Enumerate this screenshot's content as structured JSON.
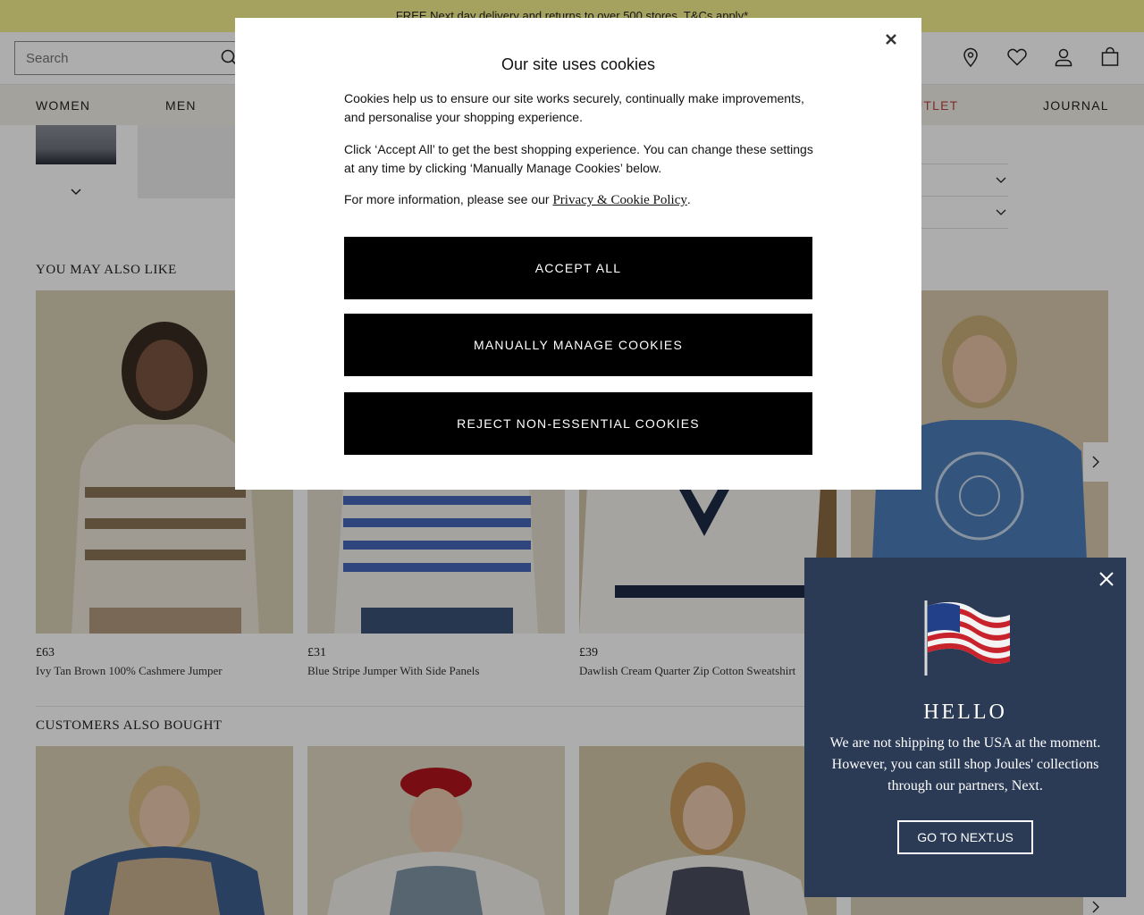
{
  "promo": {
    "text": "FREE Next day delivery and returns to over 500 stores. T&Cs apply*"
  },
  "header": {
    "search_placeholder": "Search",
    "icons": [
      "store-locator-icon",
      "wishlist-heart-icon",
      "account-icon",
      "shopping-bag-icon"
    ]
  },
  "nav": {
    "items": [
      {
        "label": "WOMEN"
      },
      {
        "label": "MEN"
      },
      {
        "label": "OUTLET"
      },
      {
        "label": "JOURNAL"
      }
    ],
    "outlet_color": "#b5453f"
  },
  "sections": {
    "also_like_title": "YOU MAY ALSO LIKE",
    "also_bought_title": "CUSTOMERS ALSO BOUGHT"
  },
  "products": [
    {
      "price": "£63",
      "name": "Ivy Tan Brown 100% Cashmere Jumper"
    },
    {
      "price": "£31",
      "name": "Blue Stripe Jumper With Side Panels"
    },
    {
      "price": "£39",
      "name": "Dawlish Cream Quarter Zip Cotton Sweatshirt"
    },
    {
      "price": "",
      "name": ""
    }
  ],
  "cookie_modal": {
    "title": "Our site uses cookies",
    "para1": "Cookies help us to ensure our site works securely, continually make improvements, and personalise your shopping experience.",
    "para2": "Click ‘Accept All’ to get the best shopping experience. You can change these settings at any time by clicking ‘Manually Manage Cookies’ below.",
    "para3_prefix": "For more information, please see our ",
    "para3_link": "Privacy & Cookie Policy",
    "para3_suffix": ".",
    "accept_label": "ACCEPT ALL",
    "manage_label": "MANUALLY MANAGE COOKIES",
    "reject_label": "REJECT NON-ESSENTIAL COOKIES"
  },
  "geo_popup": {
    "title": "HELLO",
    "message": "We are not shipping to the USA at the moment. However, you can still shop Joules' collections through our partners, Next.",
    "button_label": "GO TO NEXT.US",
    "background": "#2b3a55"
  }
}
